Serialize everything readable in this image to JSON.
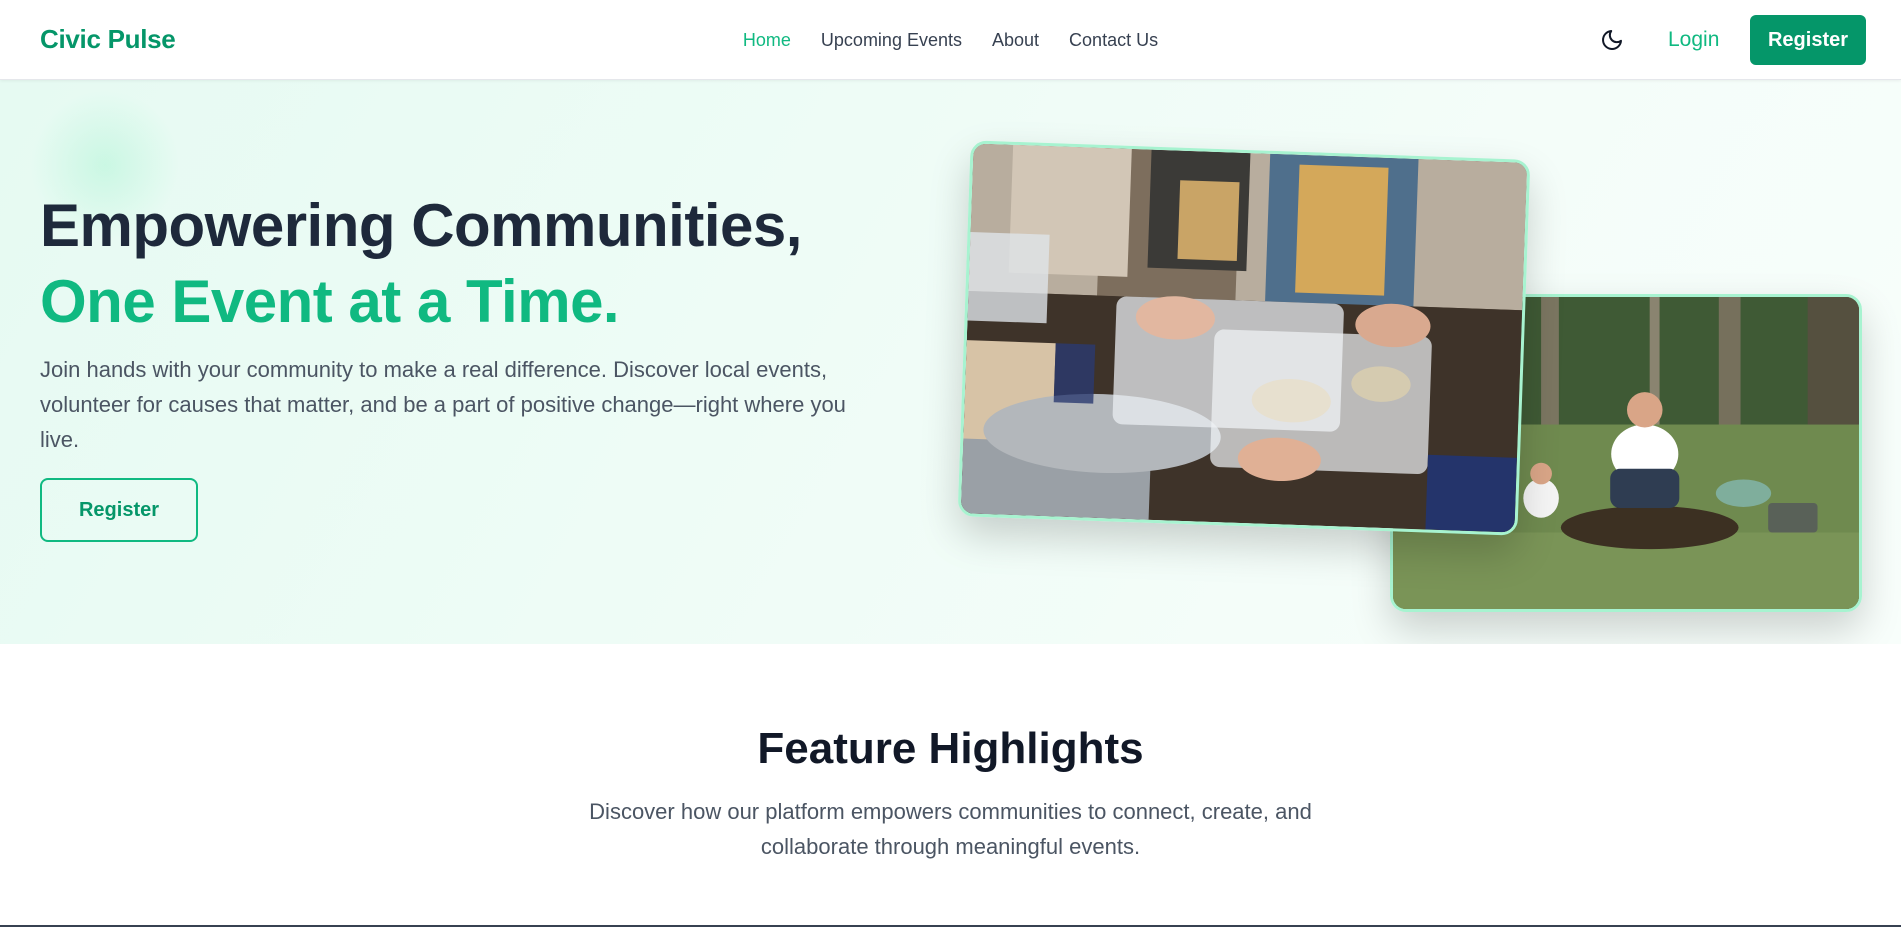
{
  "nav": {
    "brand": "Civic Pulse",
    "links": [
      {
        "label": "Home",
        "active": true
      },
      {
        "label": "Upcoming Events",
        "active": false
      },
      {
        "label": "About",
        "active": false
      },
      {
        "label": "Contact Us",
        "active": false
      }
    ],
    "theme_toggle_icon": "moon-icon",
    "login_label": "Login",
    "register_label": "Register"
  },
  "hero": {
    "title_line1": "Empowering Communities,",
    "title_line2": "One Event at a Time.",
    "description": "Join hands with your community to make a real difference. Discover local events, volunteer for causes that matter, and be a part of positive change—right where you live.",
    "register_label": "Register"
  },
  "features": {
    "title": "Feature Highlights",
    "description": "Discover how our platform empowers communities to connect, create, and collaborate through meaningful events."
  },
  "colors": {
    "brand": "#059669",
    "accent": "#10b981",
    "heading": "#1e293b",
    "text": "#4b5563"
  }
}
